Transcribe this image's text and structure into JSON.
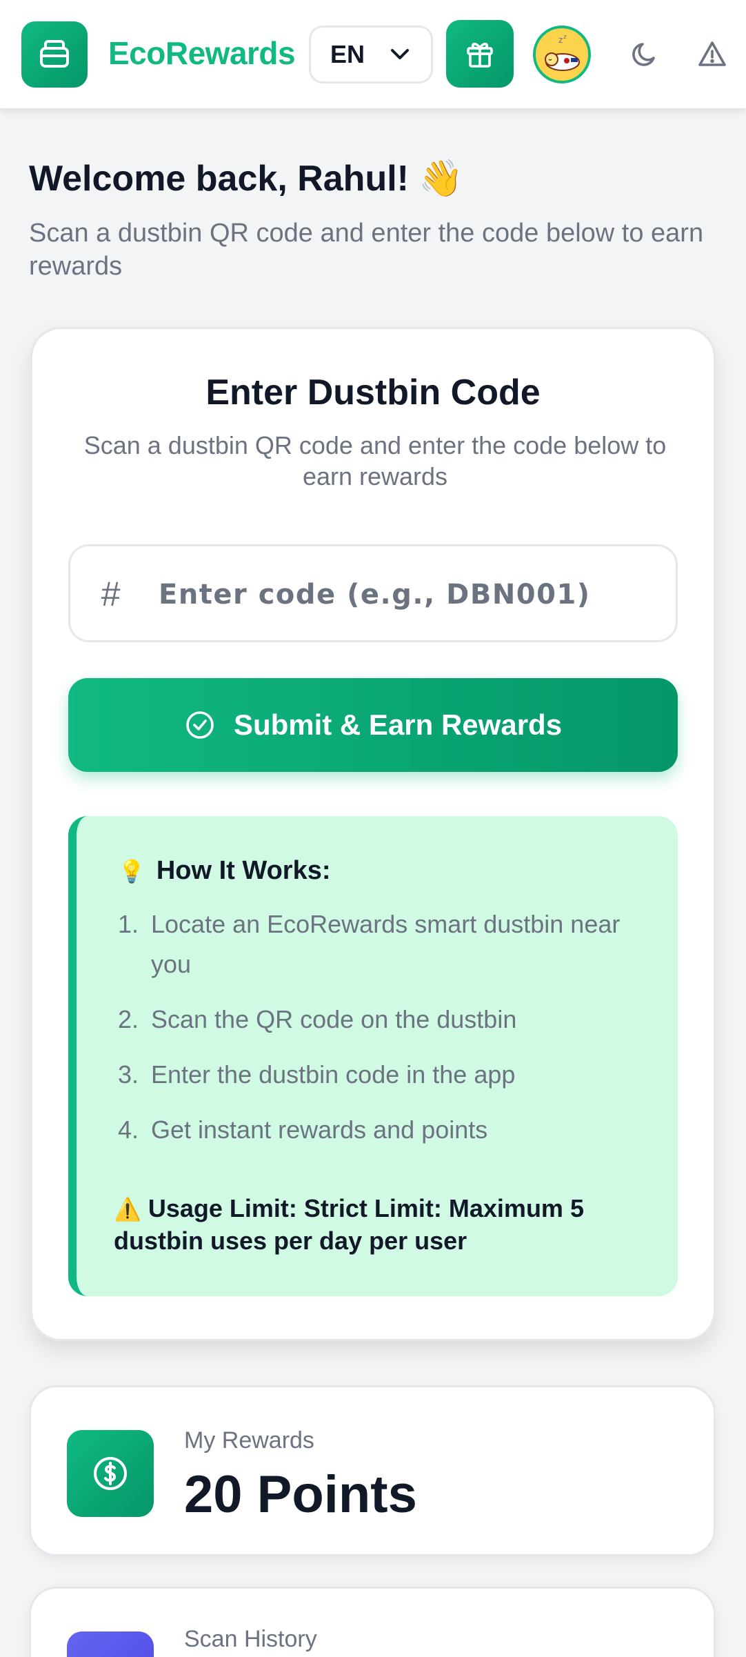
{
  "header": {
    "brand": "EcoRewards",
    "language": "EN",
    "icons": {
      "logo": "wallet-icon",
      "gift": "gift-icon",
      "avatar": "sleeping-avatar",
      "theme": "moon-icon",
      "report": "warning-icon"
    }
  },
  "welcome": {
    "title": "Welcome back, Rahul! 👋",
    "subtitle": "Scan a dustbin QR code and enter the code below to earn rewards"
  },
  "code_card": {
    "title": "Enter Dustbin Code",
    "subtitle": "Scan a dustbin QR code and enter the code below to earn rewards",
    "input_prefix": "#",
    "input_value": "",
    "input_placeholder": "Enter code (e.g., DBN001)",
    "submit_label": "Submit & Earn Rewards"
  },
  "how_it_works": {
    "title": "How It Works:",
    "title_icon": "💡",
    "steps": [
      {
        "num": "1.",
        "text": "Locate an EcoRewards smart dustbin near you"
      },
      {
        "num": "2.",
        "text": "Scan the QR code on the dustbin"
      },
      {
        "num": "3.",
        "text": "Enter the dustbin code in the app"
      },
      {
        "num": "4.",
        "text": "Get instant rewards and points"
      }
    ],
    "limit_icon": "⚠️",
    "limit_text": "Usage Limit: Strict Limit: Maximum 5 dustbin uses per day per user"
  },
  "rewards": {
    "label": "My Rewards",
    "value": "20 Points"
  },
  "history": {
    "label": "Scan History"
  },
  "colors": {
    "brand": "#10b981",
    "brand_dark": "#059669",
    "info_bg": "#d1fae5",
    "history_accent": "#6366f1"
  }
}
